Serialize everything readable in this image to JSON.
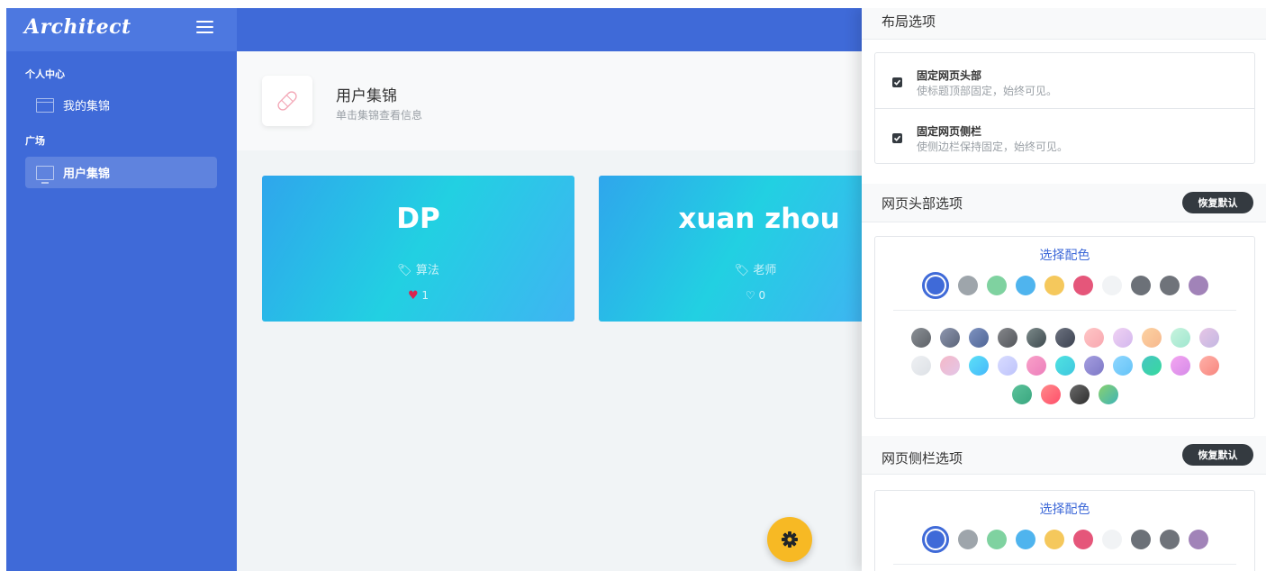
{
  "sidebar": {
    "logo": "Architect",
    "section_personal": "个人中心",
    "item_my_collection": "我的集锦",
    "section_square": "广场",
    "item_user_collection": "用户集锦"
  },
  "page": {
    "title": "用户集锦",
    "subtitle": "单击集锦查看信息"
  },
  "cards": [
    {
      "title": "DP",
      "tag": "算法",
      "likes": "1",
      "liked": true
    },
    {
      "title": "xuan zhou",
      "tag": "老师",
      "likes": "0",
      "liked": false
    }
  ],
  "settings": {
    "layout_title": "布局选项",
    "fixed_header_title": "固定网页头部",
    "fixed_header_desc": "使标题顶部固定，始终可见。",
    "fixed_sidebar_title": "固定网页侧栏",
    "fixed_sidebar_desc": "使侧边栏保持固定，始终可见。",
    "header_options_title": "网页头部选项",
    "sidebar_options_title": "网页侧栏选项",
    "reset_label": "恢复默认",
    "choose_color": "选择配色"
  },
  "colors": {
    "primary": "#3f6ad8",
    "warning": "#f7b924",
    "danger": "#d92550",
    "solid_swatches": [
      "#3f6ad8",
      "#9ea5ab",
      "#7fd2a0",
      "#4fb4ee",
      "#f5c85c",
      "#e5567a",
      "#f1f3f5",
      "#6c7178",
      "#6f737a",
      "#a183b8"
    ],
    "gradient_swatches": [
      "linear-gradient(135deg,#8c9197,#5d6167)",
      "linear-gradient(135deg,#8e97b0,#5b6478)",
      "linear-gradient(135deg,#7f93c0,#4f6596)",
      "linear-gradient(135deg,#85878b,#53565b)",
      "linear-gradient(135deg,#7c8a8a,#3e4a4f)",
      "linear-gradient(135deg,#6d7380,#3b4150)",
      "linear-gradient(135deg,#ffc6c6,#f8a7b0)",
      "linear-gradient(135deg,#f0d2f3,#d3b7ee)",
      "linear-gradient(135deg,#fcd2a2,#f7b88e)",
      "linear-gradient(135deg,#c8f4de,#9fe6cf)",
      "linear-gradient(135deg,#e7c6e6,#c3b7e2)",
      "linear-gradient(135deg,#eef0f3,#dde1e6)",
      "linear-gradient(135deg,#f5b8c7,#e3c6e8)",
      "linear-gradient(135deg,#5ce0f6,#45b8fb)",
      "linear-gradient(135deg,#d8dcff,#bec3fb)",
      "linear-gradient(135deg,#f9a0c8,#ec7fbc)",
      "linear-gradient(135deg,#4fe2e2,#3fc7de)",
      "linear-gradient(135deg,#a59ee0,#7d78c6)",
      "linear-gradient(135deg,#8ed7ff,#65c3f7)",
      "linear-gradient(135deg,#46c5c2,#37d99e)",
      "linear-gradient(135deg,#f4a6f1,#d58ae8)",
      "linear-gradient(135deg,#ffb1a8,#f7867f)",
      "linear-gradient(135deg,#5bc29a,#3aa780)",
      "linear-gradient(135deg,#ff8a8a,#ff4f6b)",
      "linear-gradient(135deg,#6a6a6a,#2e2e2e)",
      "linear-gradient(135deg,#8ad16f,#3fb4b6)"
    ]
  }
}
